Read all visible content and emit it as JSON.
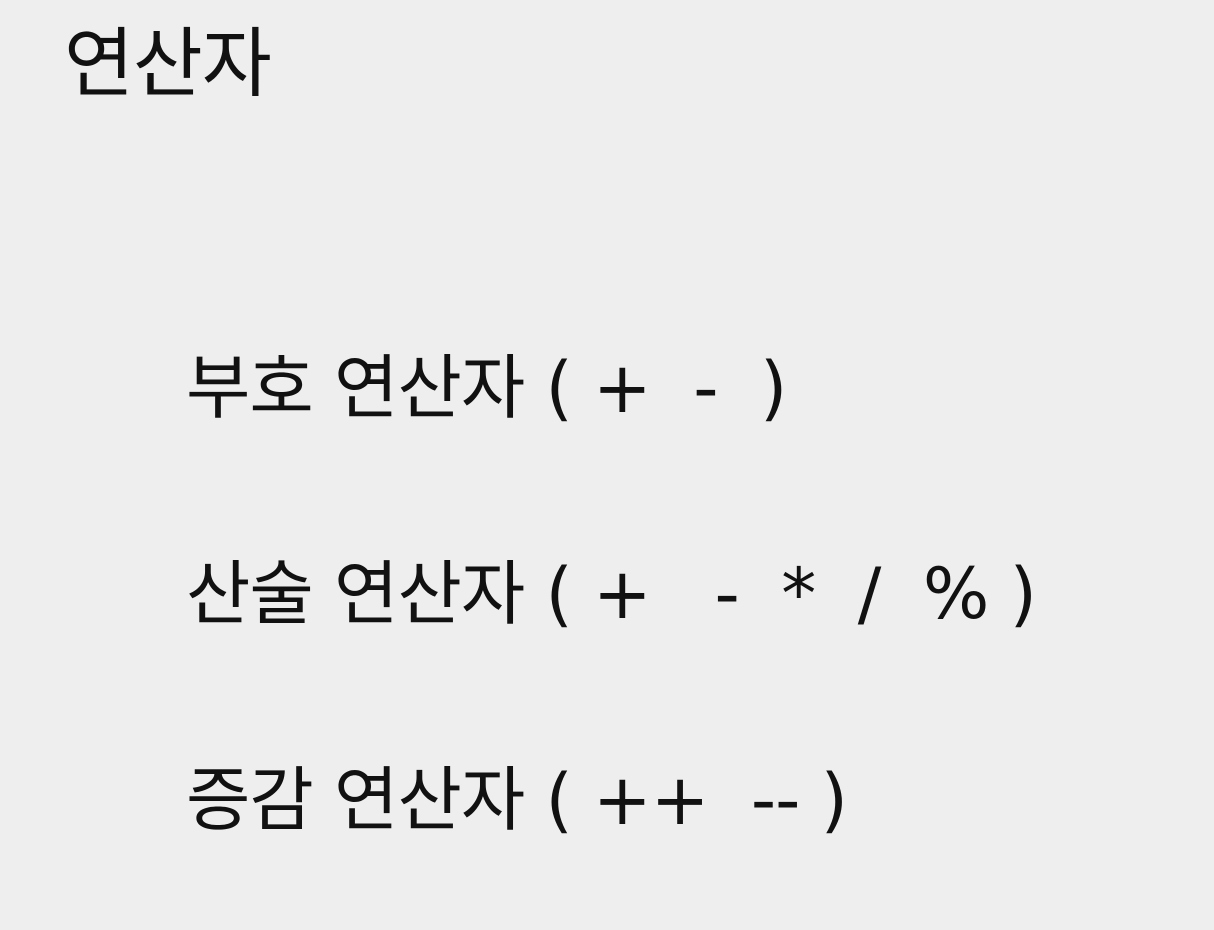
{
  "title": "연산자",
  "items": [
    {
      "label": "부호 연산자 ( +  -  )"
    },
    {
      "label": "산술 연산자 ( +   -  *  /  % )"
    },
    {
      "label": "증감 연산자 ( ++  -- )"
    }
  ]
}
